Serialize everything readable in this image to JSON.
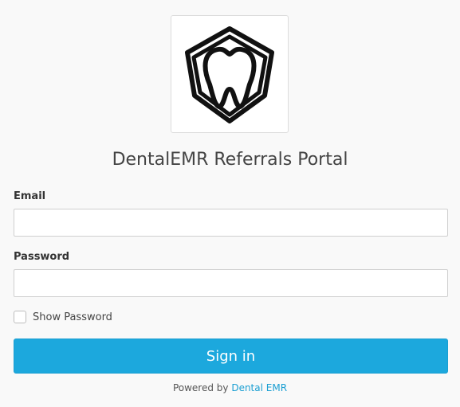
{
  "app": {
    "title": "DentalEMR Referrals Portal",
    "logo_icon": "tooth-shield-icon"
  },
  "form": {
    "email_label": "Email",
    "email_value": "",
    "email_placeholder": "",
    "password_label": "Password",
    "password_value": "",
    "password_placeholder": "",
    "show_password_label": "Show Password",
    "show_password_checked": false,
    "submit_label": "Sign in"
  },
  "footer": {
    "prefix": "Powered by",
    "link_text": "Dental EMR"
  },
  "colors": {
    "accent": "#1ca8dd",
    "background": "#f9f9f9"
  }
}
